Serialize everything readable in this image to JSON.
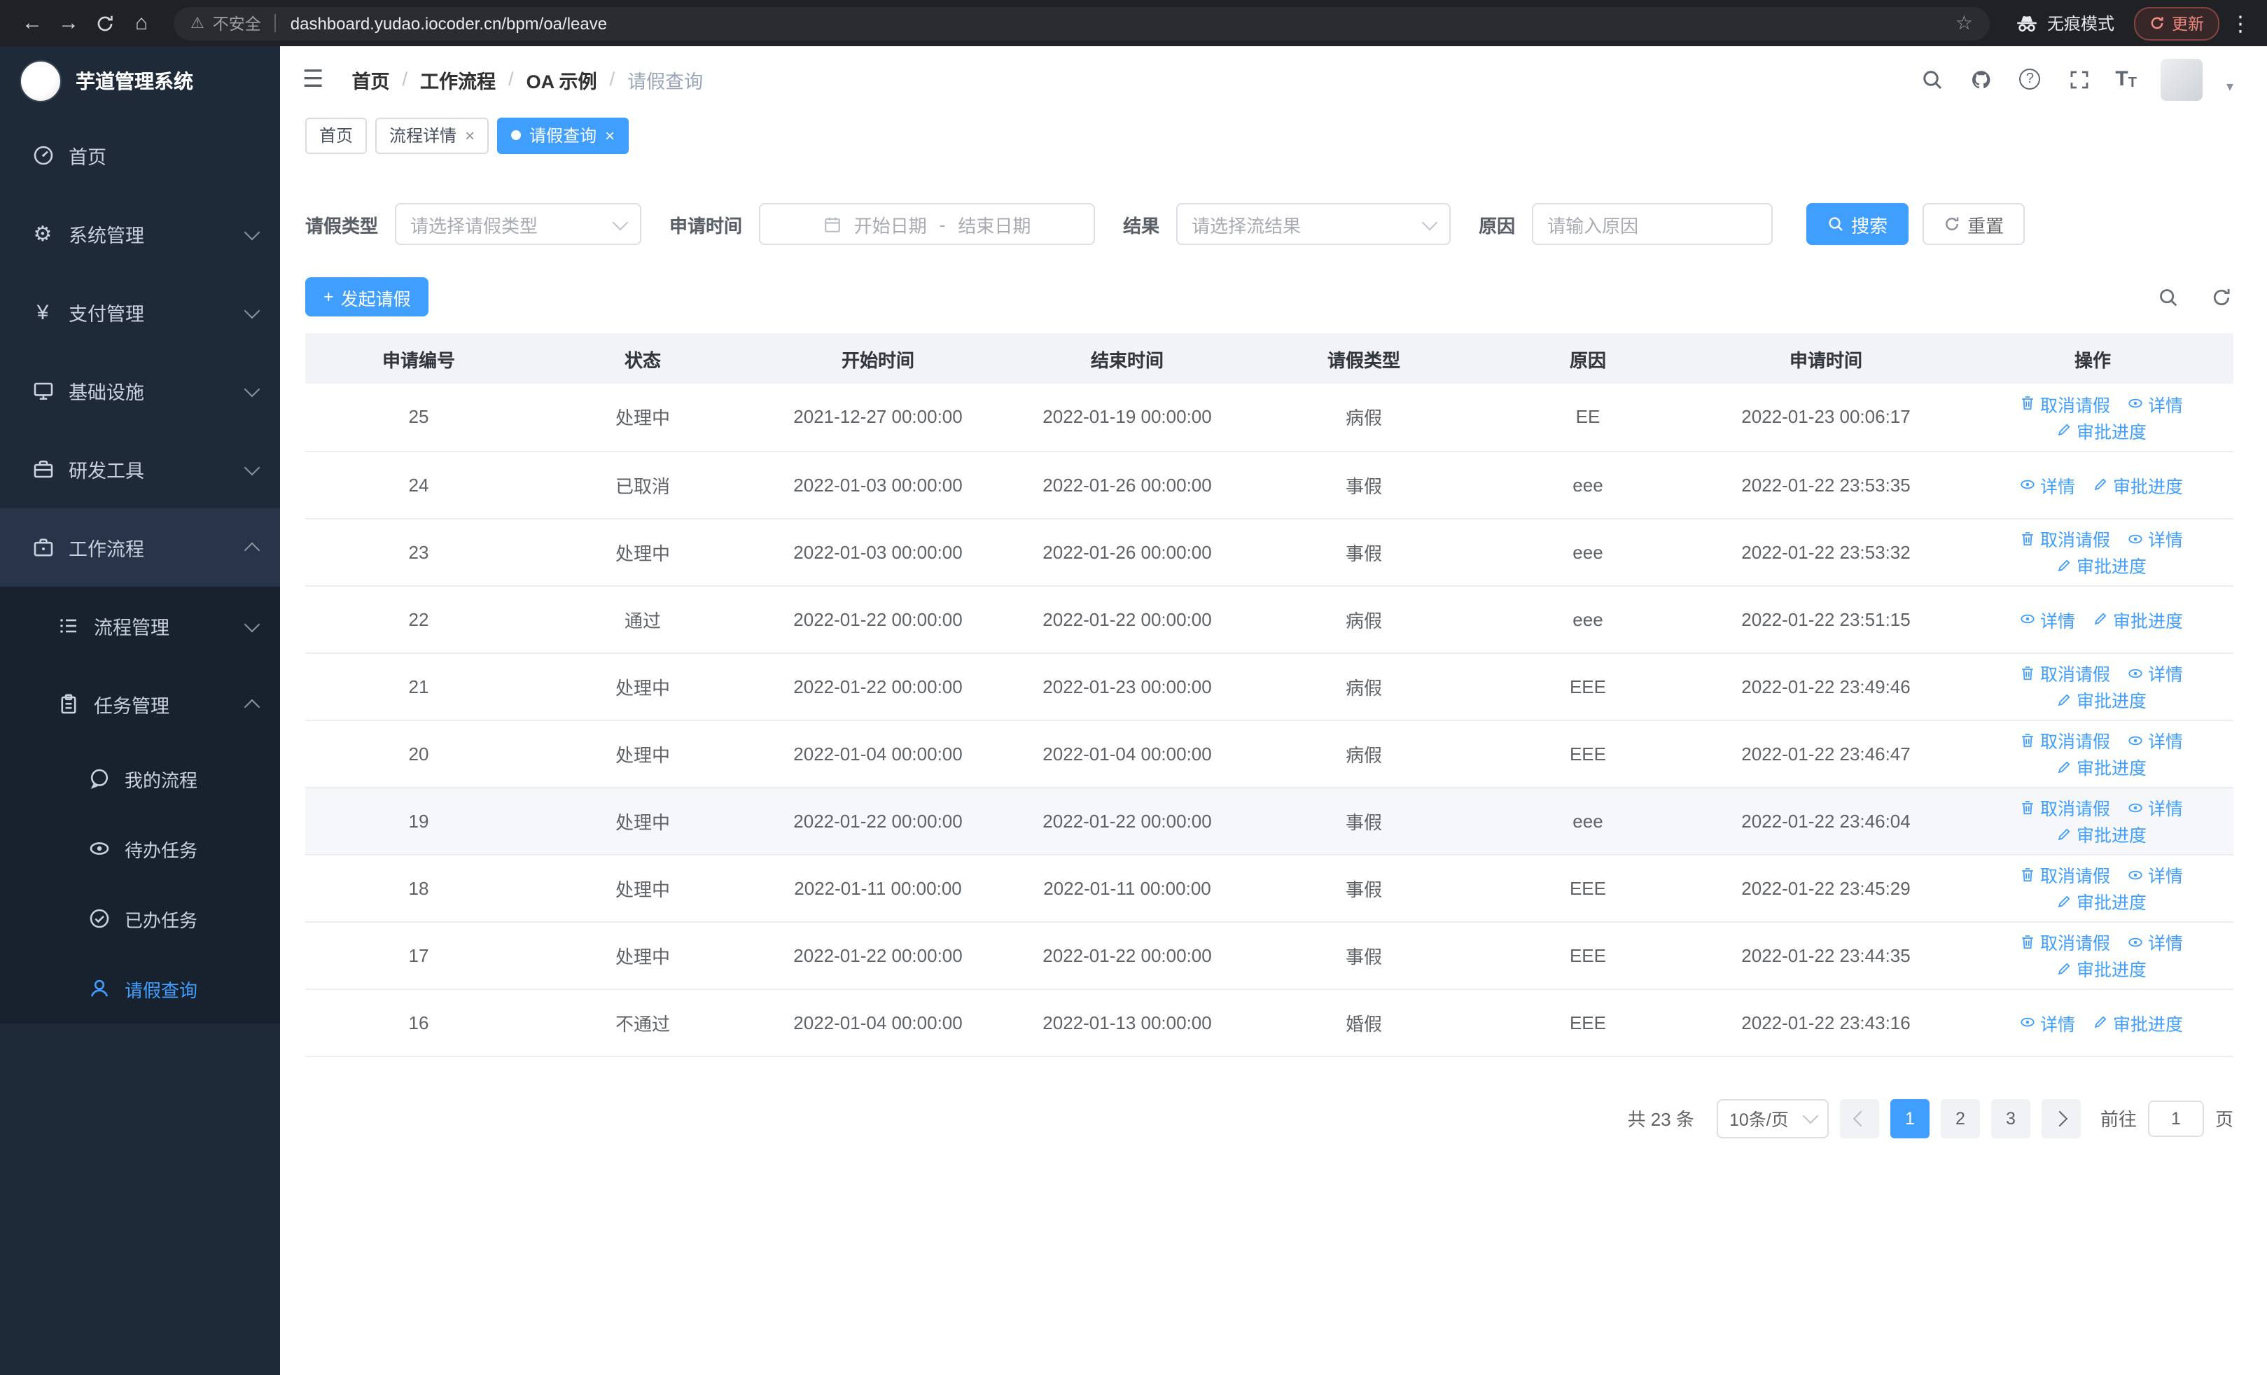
{
  "browser": {
    "security_label": "不安全",
    "url": "dashboard.yudao.iocoder.cn/bpm/oa/leave",
    "incognito_label": "无痕模式",
    "update_label": "更新"
  },
  "icons": {
    "back": "←",
    "forward": "→",
    "home": "⌂",
    "warning": "⚠",
    "star": "☆",
    "menu_dots": "⋮",
    "collapse": "☰",
    "close": "×",
    "question": "?",
    "font_size": "T",
    "gear": "⚙",
    "yen": "¥",
    "plus": "+",
    "caret": "▾"
  },
  "colors": {
    "accent": "#409eff",
    "sidebar_bg": "#1f2a39",
    "submenu_bg": "#18212e"
  },
  "sidebar": {
    "logo_title": "芋道管理系统",
    "items": [
      {
        "label": "首页"
      },
      {
        "label": "系统管理"
      },
      {
        "label": "支付管理"
      },
      {
        "label": "基础设施"
      },
      {
        "label": "研发工具"
      },
      {
        "label": "工作流程"
      },
      {
        "label": "流程管理"
      },
      {
        "label": "任务管理"
      },
      {
        "label": "我的流程"
      },
      {
        "label": "待办任务"
      },
      {
        "label": "已办任务"
      },
      {
        "label": "请假查询"
      }
    ]
  },
  "breadcrumb": {
    "separator": "/",
    "items": [
      "首页",
      "工作流程",
      "OA 示例",
      "请假查询"
    ]
  },
  "tabs": [
    {
      "label": "首页"
    },
    {
      "label": "流程详情"
    },
    {
      "label": "请假查询"
    }
  ],
  "filters": {
    "leave_type_label": "请假类型",
    "leave_type_placeholder": "请选择请假类型",
    "apply_time_label": "申请时间",
    "start_date_placeholder": "开始日期",
    "date_separator": "-",
    "end_date_placeholder": "结束日期",
    "result_label": "结果",
    "result_placeholder": "请选择流结果",
    "reason_label": "原因",
    "reason_placeholder": "请输入原因",
    "search_label": "搜索",
    "reset_label": "重置"
  },
  "toolbar": {
    "create_label": "发起请假"
  },
  "table": {
    "columns": [
      "申请编号",
      "状态",
      "开始时间",
      "结束时间",
      "请假类型",
      "原因",
      "申请时间",
      "操作"
    ],
    "actions": {
      "cancel": "取消请假",
      "detail": "详情",
      "progress": "审批进度"
    },
    "rows": [
      {
        "id": "25",
        "status": "处理中",
        "start": "2021-12-27 00:00:00",
        "end": "2022-01-19 00:00:00",
        "type": "病假",
        "reason": "EE",
        "applied": "2022-01-23 00:06:17",
        "cancellable": true,
        "highlighted": false
      },
      {
        "id": "24",
        "status": "已取消",
        "start": "2022-01-03 00:00:00",
        "end": "2022-01-26 00:00:00",
        "type": "事假",
        "reason": "eee",
        "applied": "2022-01-22 23:53:35",
        "cancellable": false,
        "highlighted": false
      },
      {
        "id": "23",
        "status": "处理中",
        "start": "2022-01-03 00:00:00",
        "end": "2022-01-26 00:00:00",
        "type": "事假",
        "reason": "eee",
        "applied": "2022-01-22 23:53:32",
        "cancellable": true,
        "highlighted": false
      },
      {
        "id": "22",
        "status": "通过",
        "start": "2022-01-22 00:00:00",
        "end": "2022-01-22 00:00:00",
        "type": "病假",
        "reason": "eee",
        "applied": "2022-01-22 23:51:15",
        "cancellable": false,
        "highlighted": false
      },
      {
        "id": "21",
        "status": "处理中",
        "start": "2022-01-22 00:00:00",
        "end": "2022-01-23 00:00:00",
        "type": "病假",
        "reason": "EEE",
        "applied": "2022-01-22 23:49:46",
        "cancellable": true,
        "highlighted": false
      },
      {
        "id": "20",
        "status": "处理中",
        "start": "2022-01-04 00:00:00",
        "end": "2022-01-04 00:00:00",
        "type": "病假",
        "reason": "EEE",
        "applied": "2022-01-22 23:46:47",
        "cancellable": true,
        "highlighted": false
      },
      {
        "id": "19",
        "status": "处理中",
        "start": "2022-01-22 00:00:00",
        "end": "2022-01-22 00:00:00",
        "type": "事假",
        "reason": "eee",
        "applied": "2022-01-22 23:46:04",
        "cancellable": true,
        "highlighted": true
      },
      {
        "id": "18",
        "status": "处理中",
        "start": "2022-01-11 00:00:00",
        "end": "2022-01-11 00:00:00",
        "type": "事假",
        "reason": "EEE",
        "applied": "2022-01-22 23:45:29",
        "cancellable": true,
        "highlighted": false
      },
      {
        "id": "17",
        "status": "处理中",
        "start": "2022-01-22 00:00:00",
        "end": "2022-01-22 00:00:00",
        "type": "事假",
        "reason": "EEE",
        "applied": "2022-01-22 23:44:35",
        "cancellable": true,
        "highlighted": false
      },
      {
        "id": "16",
        "status": "不通过",
        "start": "2022-01-04 00:00:00",
        "end": "2022-01-13 00:00:00",
        "type": "婚假",
        "reason": "EEE",
        "applied": "2022-01-22 23:43:16",
        "cancellable": false,
        "highlighted": false
      }
    ]
  },
  "pagination": {
    "total_label": "共 23 条",
    "page_size": "10条/页",
    "pages": [
      "1",
      "2",
      "3"
    ],
    "active_page": "1",
    "goto_label": "前往",
    "goto_value": "1",
    "page_unit": "页"
  }
}
